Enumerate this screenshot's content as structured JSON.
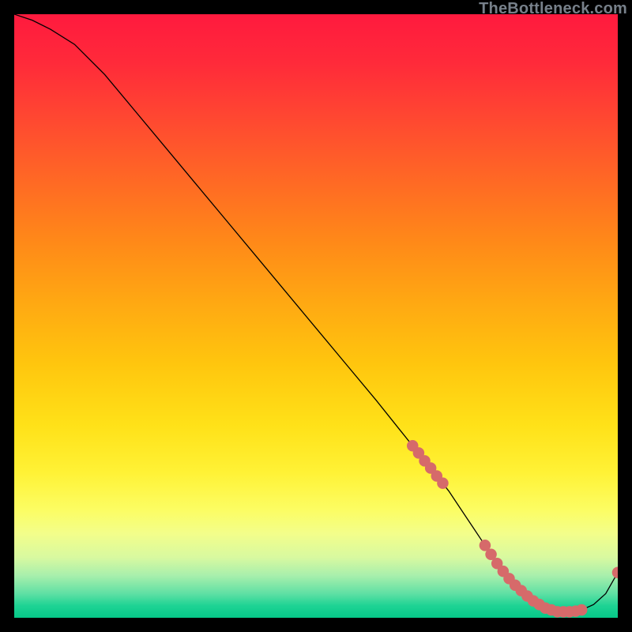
{
  "watermark": "TheBottleneck.com",
  "colors": {
    "marker": "#d66a6a",
    "curve": "#000000"
  },
  "chart_data": {
    "type": "line",
    "title": "",
    "xlabel": "",
    "ylabel": "",
    "xlim": [
      0,
      100
    ],
    "ylim": [
      0,
      100
    ],
    "x": [
      0,
      3,
      6,
      10,
      15,
      20,
      25,
      30,
      35,
      40,
      45,
      50,
      55,
      60,
      62,
      64,
      66,
      68,
      70,
      72,
      74,
      76,
      78,
      80,
      82,
      84,
      86,
      88,
      90,
      92,
      94,
      96,
      98,
      100
    ],
    "y": [
      100,
      99,
      97.5,
      95,
      90,
      84,
      78,
      72,
      66,
      60,
      54,
      48,
      42,
      36,
      33.5,
      31,
      28.5,
      26,
      23.5,
      21,
      18,
      15,
      12,
      9,
      6.5,
      4.5,
      2.8,
      1.6,
      1.0,
      1.0,
      1.3,
      2.2,
      4.0,
      7.5
    ],
    "marker_points": [
      {
        "x": 66,
        "y": 28.5
      },
      {
        "x": 67,
        "y": 27.3
      },
      {
        "x": 68,
        "y": 26.0
      },
      {
        "x": 69,
        "y": 24.8
      },
      {
        "x": 70,
        "y": 23.5
      },
      {
        "x": 71,
        "y": 22.3
      },
      {
        "x": 78,
        "y": 12.0
      },
      {
        "x": 79,
        "y": 10.5
      },
      {
        "x": 80,
        "y": 9.0
      },
      {
        "x": 81,
        "y": 7.7
      },
      {
        "x": 82,
        "y": 6.5
      },
      {
        "x": 83,
        "y": 5.4
      },
      {
        "x": 84,
        "y": 4.5
      },
      {
        "x": 85,
        "y": 3.6
      },
      {
        "x": 86,
        "y": 2.8
      },
      {
        "x": 87,
        "y": 2.2
      },
      {
        "x": 88,
        "y": 1.6
      },
      {
        "x": 89,
        "y": 1.3
      },
      {
        "x": 90,
        "y": 1.0
      },
      {
        "x": 91,
        "y": 1.0
      },
      {
        "x": 92,
        "y": 1.0
      },
      {
        "x": 93,
        "y": 1.1
      },
      {
        "x": 94,
        "y": 1.3
      },
      {
        "x": 100,
        "y": 7.5
      }
    ]
  }
}
